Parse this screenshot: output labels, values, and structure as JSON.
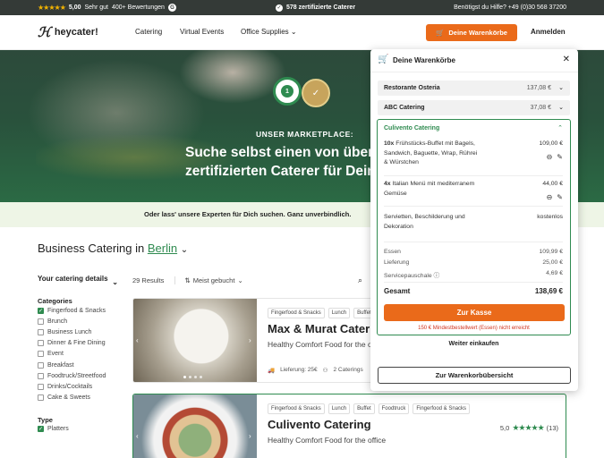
{
  "topbar": {
    "rating": "5,00",
    "rating_text": "Sehr gut",
    "reviews": "400+ Bewertungen",
    "google_letter": "G",
    "caterers": "578 zertifizierte Caterer",
    "help": "Benötigst du Hilfe? +49 (0)30 568 37200"
  },
  "nav": {
    "logo_mark": "ℋ",
    "logo_text": "heycater!",
    "items": [
      "Catering",
      "Virtual Events",
      "Office Supplies"
    ],
    "cart_button": "Deine Warenkörbe",
    "login": "Anmelden"
  },
  "hero": {
    "subtitle": "UNSER MARKETPLACE:",
    "title_line1": "Suche selbst einen von über",
    "title_line2": "zertifizierten Caterer für Dein",
    "seal1": "1",
    "seal2": "✓"
  },
  "info_strip": "Oder lass' unsere Experten für Dich suchen. Ganz unverbindlich.",
  "section": {
    "title": "Business Catering in",
    "city": "Berlin"
  },
  "sidebar": {
    "heading": "Your catering details",
    "categories_label": "Categories",
    "categories": [
      {
        "label": "Fingerfood & Snacks",
        "checked": true
      },
      {
        "label": "Brunch",
        "checked": false
      },
      {
        "label": "Business Lunch",
        "checked": false
      },
      {
        "label": "Dinner & Fine Dining",
        "checked": false
      },
      {
        "label": "Event",
        "checked": false
      },
      {
        "label": "Breakfast",
        "checked": false
      },
      {
        "label": "Foodtruck/Streetfood",
        "checked": false
      },
      {
        "label": "Drinks/Cocktails",
        "checked": false
      },
      {
        "label": "Cake & Sweets",
        "checked": false
      }
    ],
    "type_label": "Type",
    "types": [
      {
        "label": "Platters",
        "checked": true
      }
    ]
  },
  "results": {
    "count": "29 Results",
    "sort": "Meist gebucht"
  },
  "cards": [
    {
      "tags": [
        "Fingerfood & Snacks",
        "Lunch",
        "Buffet"
      ],
      "title": "Max & Murat Catering",
      "subtitle": "Healthy Comfort Food for the office",
      "delivery": "Lieferung: 25€",
      "caterings": "2 Caterings"
    },
    {
      "tags": [
        "Fingerfood & Snacks",
        "Lunch",
        "Buffet",
        "Foodtruck",
        "Fingerfood & Snacks"
      ],
      "title": "Culivento Catering",
      "subtitle": "Healthy Comfort Food for the office",
      "rating": "5,0",
      "stars": "★★★★★",
      "reviews": "(13)"
    }
  ],
  "cart": {
    "title": "Deine Warenkörbe",
    "restaurants": [
      {
        "name": "Restorante Osteria",
        "price": "137,08 €"
      },
      {
        "name": "ABC Catering",
        "price": "37,08 €"
      }
    ],
    "open": {
      "name": "Culivento Catering",
      "items": [
        {
          "qty": "10x",
          "desc": "Frühstücks-Buffet mit Bagels, Sandwich, Baguette, Wrap, Rührei & Würstchen",
          "price": "109,00 €"
        },
        {
          "qty": "4x",
          "desc": "Italian Menü mit mediterranem Gemüse",
          "price": "44,00 €"
        }
      ],
      "extra_label": "Servietten, Beschilderung und Dekoration",
      "extra_value": "kostenlos",
      "food_label": "Essen",
      "food_value": "109,99 €",
      "delivery_label": "Lieferung",
      "delivery_value": "25,00 €",
      "service_label": "Servicepauschale",
      "service_value": "4,69 €",
      "total_label": "Gesamt",
      "total_value": "138,69 €",
      "checkout": "Zur Kasse",
      "min_order": "150 € Mindestbestellwert (Essen) nicht erreicht",
      "continue": "Weiter einkaufen"
    },
    "overview": "Zur Warenkorbübersicht"
  }
}
